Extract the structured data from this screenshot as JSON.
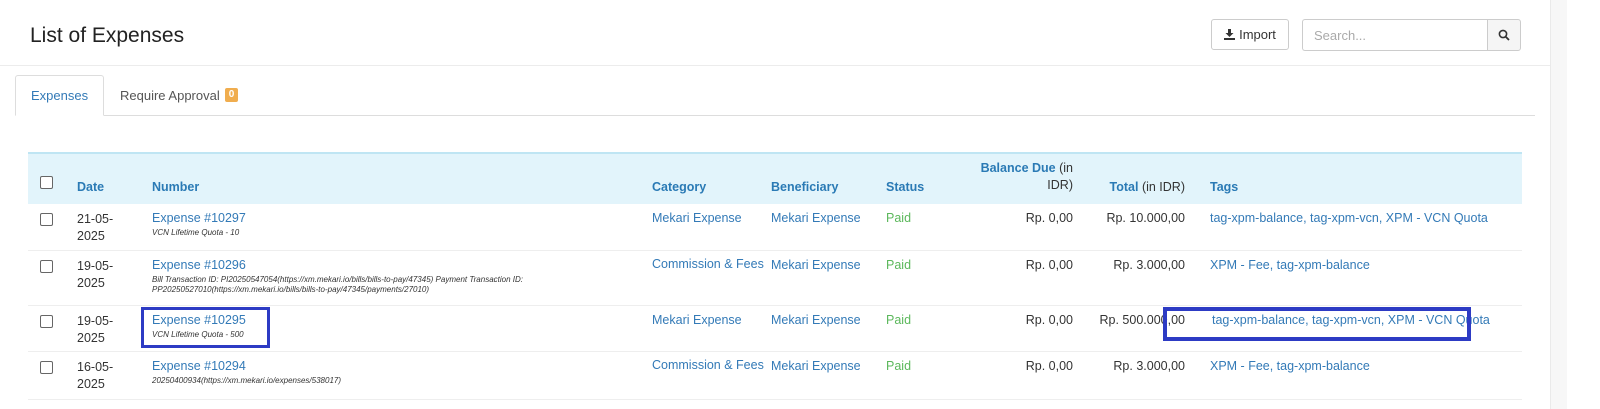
{
  "header": {
    "title": "List of Expenses",
    "import_label": "Import",
    "search_placeholder": "Search..."
  },
  "tabs": [
    {
      "label": "Expenses"
    },
    {
      "label": "Require Approval",
      "badge": "0"
    }
  ],
  "table": {
    "columns": {
      "date": "Date",
      "number": "Number",
      "category": "Category",
      "beneficiary": "Beneficiary",
      "status": "Status",
      "balance_due_a": "Balance Due",
      "balance_due_b": "(in",
      "balance_due_c": "IDR)",
      "total_a": "Total",
      "total_b": "(in IDR)",
      "tags": "Tags"
    },
    "rows": [
      {
        "date_a": "21-05-",
        "date_b": "2025",
        "number": "Expense #10297",
        "desc": "VCN Lifetime Quota - 10",
        "category": "Mekari Expense",
        "beneficiary": "Mekari Expense",
        "status": "Paid",
        "balance_due": "Rp. 0,00",
        "total": "Rp. 10.000,00",
        "tags": "tag-xpm-balance, tag-xpm-vcn, XPM - VCN Quota"
      },
      {
        "date_a": "19-05-",
        "date_b": "2025",
        "number": "Expense #10296",
        "desc": "Bill Transaction ID: PI20250547054(https://xm.mekari.io/bills/bills-to-pay/47345) Payment Transaction ID: PP20250527010(https://xm.mekari.io/bills/bills-to-pay/47345/payments/27010)",
        "category": "Commission & Fees",
        "beneficiary": "Mekari Expense",
        "status": "Paid",
        "balance_due": "Rp. 0,00",
        "total": "Rp. 3.000,00",
        "tags": "XPM - Fee, tag-xpm-balance"
      },
      {
        "date_a": "19-05-",
        "date_b": "2025",
        "number": "Expense #10295",
        "desc": "VCN Lifetime Quota - 500",
        "category": "Mekari Expense",
        "beneficiary": "Mekari Expense",
        "status": "Paid",
        "balance_due": "Rp. 0,00",
        "total": "Rp. 500.000,00",
        "tags": "tag-xpm-balance, tag-xpm-vcn, XPM - VCN Quota"
      },
      {
        "date_a": "16-05-",
        "date_b": "2025",
        "number": "Expense #10294",
        "desc": "20250400934(https://xm.mekari.io/expenses/538017)",
        "category": "Commission & Fees",
        "beneficiary": "Mekari Expense",
        "status": "Paid",
        "balance_due": "Rp. 0,00",
        "total": "Rp. 3.000,00",
        "tags": "XPM - Fee, tag-xpm-balance"
      }
    ]
  }
}
